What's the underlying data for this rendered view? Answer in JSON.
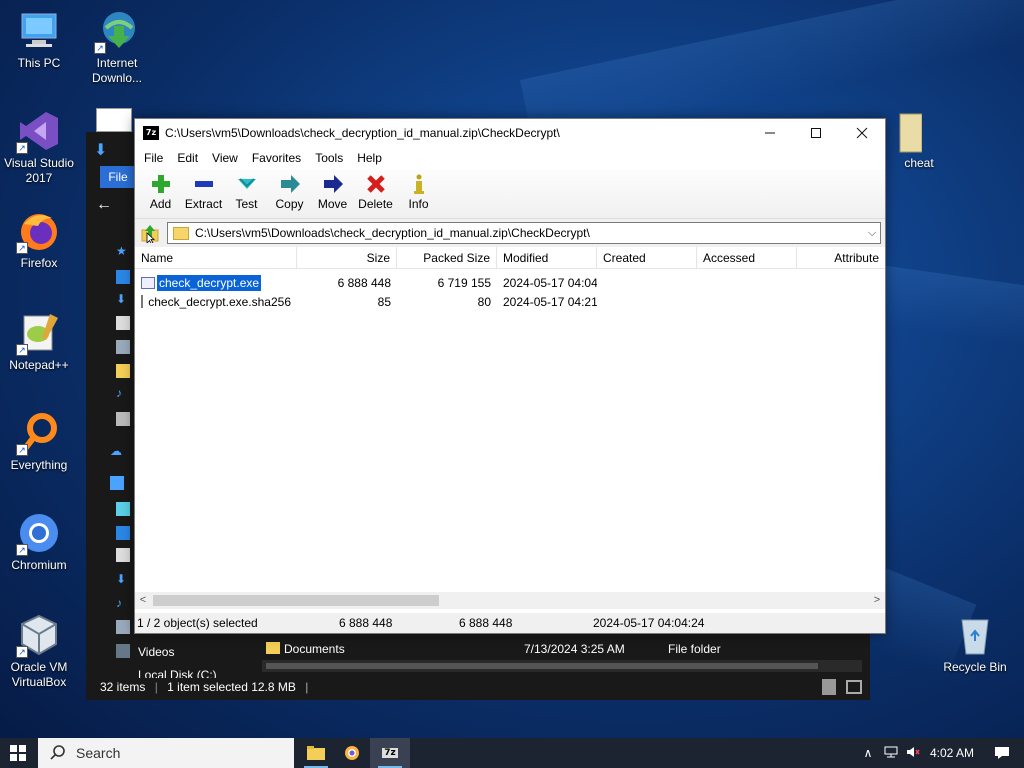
{
  "desktop": {
    "icons": [
      {
        "label": "This PC",
        "icon": "pc-icon"
      },
      {
        "label": "Internet Downlo...",
        "icon": "idm-icon"
      },
      {
        "label": "Visual Studio 2017",
        "icon": "visual-studio-icon"
      },
      {
        "label": "Firefox",
        "icon": "firefox-icon"
      },
      {
        "label": "Notepad++",
        "icon": "notepadpp-icon"
      },
      {
        "label": "Everything",
        "icon": "everything-icon"
      },
      {
        "label": "Chromium",
        "icon": "chromium-icon"
      },
      {
        "label": "Oracle VM VirtualBox",
        "icon": "virtualbox-icon"
      },
      {
        "label": "Recycle Bin",
        "icon": "recycle-bin-icon"
      },
      {
        "label": "cheat",
        "icon": "folder-icon"
      }
    ]
  },
  "explorer": {
    "file_tab": "File",
    "nav_videos": "Videos",
    "nav_local_disk": "Local Disk (C:)",
    "row": {
      "name": "Documents",
      "modified": "7/13/2024 3:25 AM",
      "type": "File folder"
    },
    "status": {
      "items": "32 items",
      "selected": "1 item selected  12.8 MB"
    }
  },
  "sevenzip": {
    "title": "C:\\Users\\vm5\\Downloads\\check_decryption_id_manual.zip\\CheckDecrypt\\",
    "menu": [
      "File",
      "Edit",
      "View",
      "Favorites",
      "Tools",
      "Help"
    ],
    "toolbar": [
      {
        "label": "Add",
        "icon": "add-icon"
      },
      {
        "label": "Extract",
        "icon": "extract-icon"
      },
      {
        "label": "Test",
        "icon": "test-icon"
      },
      {
        "label": "Copy",
        "icon": "copy-icon"
      },
      {
        "label": "Move",
        "icon": "move-icon"
      },
      {
        "label": "Delete",
        "icon": "delete-icon"
      },
      {
        "label": "Info",
        "icon": "info-icon"
      }
    ],
    "address": "C:\\Users\\vm5\\Downloads\\check_decryption_id_manual.zip\\CheckDecrypt\\",
    "columns": [
      "Name",
      "Size",
      "Packed Size",
      "Modified",
      "Created",
      "Accessed",
      "Attribute"
    ],
    "files": [
      {
        "name": "check_decrypt.exe",
        "size": "6 888 448",
        "packed": "6 719 155",
        "modified": "2024-05-17 04:04",
        "selected": true
      },
      {
        "name": "check_decrypt.exe.sha256",
        "size": "85",
        "packed": "80",
        "modified": "2024-05-17 04:21",
        "selected": false
      }
    ],
    "status": {
      "selection": "1 / 2 object(s) selected",
      "size": "6 888 448",
      "packed": "6 888 448",
      "modified": "2024-05-17 04:04:24"
    }
  },
  "taskbar": {
    "search_placeholder": "Search",
    "clock": "4:02 AM"
  }
}
